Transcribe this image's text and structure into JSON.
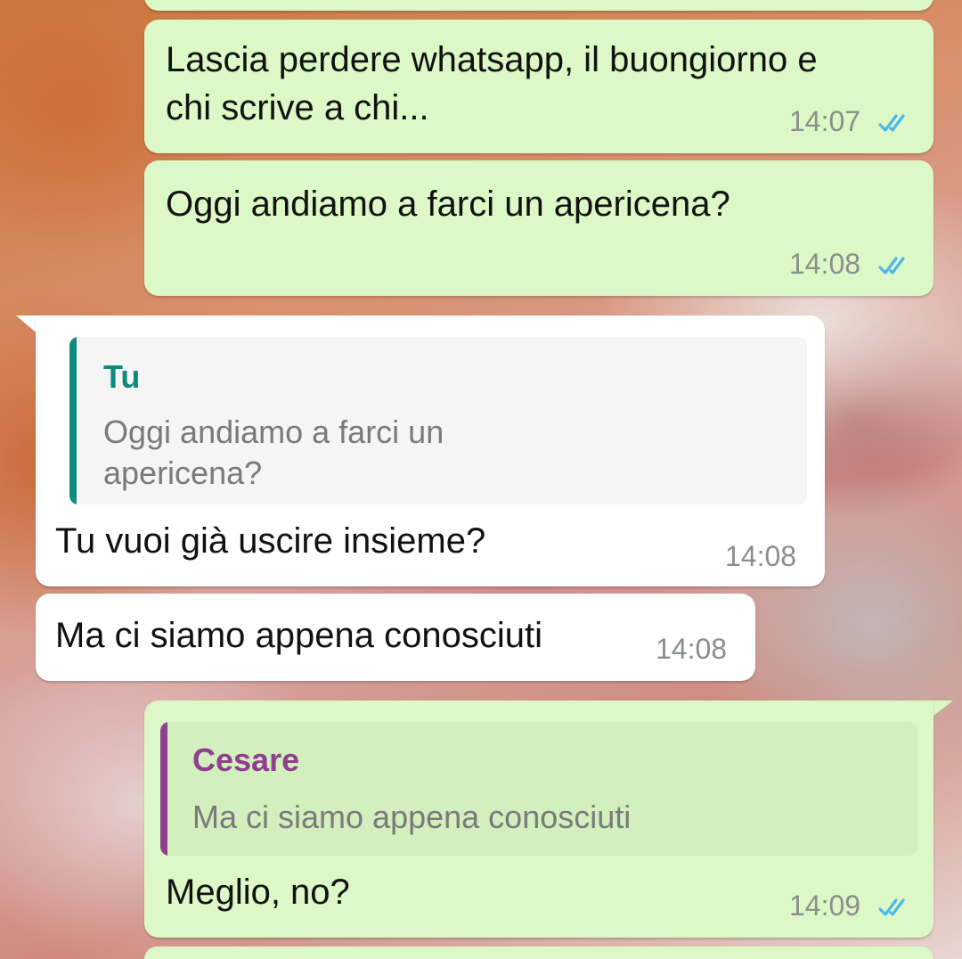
{
  "chat": {
    "messages": [
      {
        "direction": "outgoing",
        "lines": [
          "Lascia perdere whatsapp, il buongiorno e",
          "chi scrive a chi..."
        ],
        "time": "14:07",
        "status": "read"
      },
      {
        "direction": "outgoing",
        "lines": [
          "Oggi andiamo a farci un apericena?"
        ],
        "time": "14:08",
        "status": "read"
      },
      {
        "direction": "incoming",
        "quote": {
          "author": "Tu",
          "lines": [
            "Oggi andiamo a farci un",
            "apericena?"
          ]
        },
        "lines": [
          "Tu vuoi già uscire insieme?"
        ],
        "time": "14:08"
      },
      {
        "direction": "incoming",
        "lines": [
          "Ma ci siamo appena conosciuti"
        ],
        "time": "14:08"
      },
      {
        "direction": "outgoing",
        "quote": {
          "author": "Cesare",
          "lines": [
            "Ma ci siamo appena conosciuti"
          ]
        },
        "lines": [
          "Meglio, no?"
        ],
        "time": "14:09",
        "status": "read"
      }
    ]
  },
  "icons": {
    "read_receipt": "double-check-icon"
  },
  "colors": {
    "outgoing_bubble": "#dcf8c6",
    "incoming_bubble": "#ffffff",
    "read_ticks": "#4fb6ec",
    "quote_author_self": "#0f8a7e",
    "quote_author_contact": "#8e3f8e",
    "quote_bar_self": "#0f8a7e",
    "quote_bar_contact": "#8e3f8e"
  }
}
